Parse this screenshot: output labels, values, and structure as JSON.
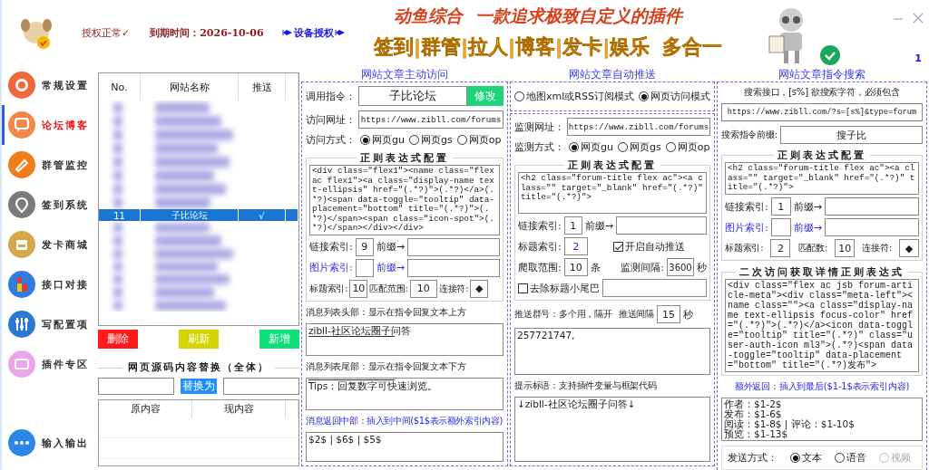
{
  "header": {
    "status": "授权正常✓",
    "expiry": "到期时间：2026-10-06",
    "device_auth": "设备授权",
    "banner_title": "动鱼综合",
    "banner_slogan": "一款追求极致自定义的插件",
    "banner_features": "签到|群管|拉人|博客|发卡|娱乐",
    "banner_suffix": "多合一",
    "badge": "1"
  },
  "sidebar": {
    "items": [
      {
        "label": "常规设置",
        "color": "#f0683c",
        "selected": false
      },
      {
        "label": "论坛博客",
        "color": "#f2884a",
        "selected": true
      },
      {
        "label": "群管监控",
        "color": "#ee7d1a",
        "selected": false
      },
      {
        "label": "签到系统",
        "color": "#7a7a7a",
        "selected": false
      },
      {
        "label": "发卡商城",
        "color": "#d4a84b",
        "selected": false
      },
      {
        "label": "接口对接",
        "color": "#2f7de1",
        "selected": false
      },
      {
        "label": "写配置项",
        "color": "#2a78d4",
        "selected": false
      },
      {
        "label": "插件专区",
        "color": "#eaa6e8",
        "selected": false
      },
      {
        "label": "输入输出",
        "color": "#2e86e8",
        "selected": false
      }
    ]
  },
  "site_table": {
    "columns": [
      "No.",
      "网站名称",
      "推送"
    ],
    "rows": [
      {
        "no": "11",
        "name": "子比论坛",
        "push": "√",
        "selected": true
      }
    ]
  },
  "actions": [
    {
      "label": "删除",
      "color": "#ff1a1a"
    },
    {
      "label": "刷新",
      "color": "#d4d400"
    },
    {
      "label": "新增",
      "color": "#10e07a"
    }
  ],
  "replace": {
    "title": "网页源码内容替换（全体）",
    "button": "替换为",
    "columns": [
      "原内容",
      "现内容"
    ]
  },
  "active_visit": {
    "title": "网站文章主动访问",
    "command_label": "调用指令：",
    "command_value": "子比论坛",
    "modify_button": "修改",
    "url_label": "访问网址：",
    "url": "https://www.zibll.com/forums",
    "method_label": "访问方式：",
    "methods": [
      {
        "label": "网页gu",
        "selected": true
      },
      {
        "label": "网页gs",
        "selected": false
      },
      {
        "label": "网页op",
        "selected": false
      }
    ],
    "regex_title": "正则表达式配置",
    "regex": "<div class=\"flex1\"><name class=\"flex ac flex1\"><a class=\"display-name text-ellipsis\" href=\"(.*?)\">(.*?)</a>(.*?)<span data-toggle=\"tooltip\" data-placement=\"bottom\" title=\"(.*?)\">(.*?)</span><span class=\"icon-spot\">(.*?)</span></div></div>",
    "link_index": {
      "label": "链接索引:",
      "value": "9",
      "prefix_label": "前缀→"
    },
    "image_index": {
      "label": "图片索引:",
      "prefix_label": "前缀→",
      "highlight": true
    },
    "title_index": {
      "label": "标题索引:",
      "value": "10"
    },
    "match_range": {
      "label": "匹配范围:",
      "value": "10"
    },
    "joiner": {
      "label": "连接符:",
      "value": "◆"
    },
    "list_header": {
      "label": "消息列表头部：显示在指令回复文本上方",
      "text": "zibll-社区论坛圈子问答"
    },
    "list_footer": {
      "label": "消息列表尾部：显示在指令回复文本下方",
      "text": "Tips：回复数字可快速浏览。"
    },
    "middle_return": {
      "label": "消息返回中部：插入到中间($1$表示额外索引内容)",
      "text": "$2$ | $6$ | $5$",
      "highlight": true
    }
  },
  "auto_push": {
    "title": "网站文章自动推送",
    "modes": [
      {
        "label": "地图xml或RSS订阅模式",
        "selected": false
      },
      {
        "label": "网页访问模式",
        "selected": true
      }
    ],
    "url_label": "监测网址：",
    "url": "https://www.zibll.com/forums",
    "method_label": "监测方式：",
    "methods": [
      {
        "label": "网页gu",
        "selected": true
      },
      {
        "label": "网页gs",
        "selected": false
      },
      {
        "label": "网页op",
        "selected": false
      }
    ],
    "regex_title": "正则表达式配置",
    "regex": "<h2 class=\"forum-title flex ac\"><a class=\"\" target=\"_blank\" href=\"(.*?)\" title=\"(.*?)\">",
    "link_index": {
      "label": "链接索引:",
      "value": "1",
      "prefix_label": "前缀→"
    },
    "title_index": {
      "label": "标题索引:",
      "value": "2"
    },
    "auto_push": {
      "label": "开启自动推送",
      "checked": true
    },
    "crawl_range": {
      "label": "爬取范围:",
      "value": "10",
      "unit": "条"
    },
    "interval": {
      "label": "监测间隔:",
      "value": "3600",
      "unit": "秒"
    },
    "strip_tail": {
      "label": "去除标题小尾巴",
      "checked": false
    },
    "groups": {
      "label": "推送群号：多个用，隔开",
      "interval_label": "推送间隔",
      "interval": "15",
      "unit": "秒",
      "text": "257721747,"
    },
    "hint": {
      "label": "提示标语：支持插件变量与框架代码",
      "text": "↓zibll-社区论坛圈子问答↓"
    }
  },
  "command_search": {
    "title": "网站文章指令搜索",
    "api_label": "搜索接口，[s%] 欲搜索字符，必须包含",
    "api_url": "https://www.zibll.com/?s=[s%]&type=forum",
    "prefix_label": "搜索指令前缀:",
    "prefix_value": "搜子比",
    "regex_title": "正则表达式配置",
    "regex": "<h2 class=\"forum-title flex ac\"><a class=\"\" target=\"_blank\" href=\"(.*?)\" title=\"(.*?)\">",
    "link_index": {
      "label": "链接索引:",
      "value": "1",
      "prefix_label": "前缀→"
    },
    "image_index": {
      "label": "图片索引:",
      "prefix_label": "前缀→",
      "highlight": true
    },
    "title_index": {
      "label": "标题索引:",
      "value": "2"
    },
    "match_count": {
      "label": "匹配数:",
      "value": "10"
    },
    "joiner": {
      "label": "连接符:",
      "value": "◆"
    },
    "detail_title": "二次访问获取详情正则表达式",
    "detail_regex": "<div class=\"flex ac jsb forum-article-meta\"><div class=\"meta-left\"><name class=\"\"><a class=\"display-name text-ellipsis focus-color\" href=\"(.*?)\">(.*?)</a><icon data-toggle=\"tooltip\" title=\"(.*?)\" class=\"user-auth-icon ml3\">(.*?)<span data-toggle=\"tooltip\" data-placement=\"bottom\" title=\"(.*?)发布\">",
    "extra_return": {
      "label": "额外返回：插入到最后($1-1$表示索引内容)",
      "text": "作者：$1-2$\n发布：$1-6$\n阅读：$1-8$ | 评论：$1-10$\n预览：$1-13$",
      "highlight": true
    },
    "send_label": "发送方式：",
    "send_options": [
      {
        "label": "文本",
        "selected": true,
        "disabled": false
      },
      {
        "label": "语音",
        "selected": false,
        "disabled": false
      },
      {
        "label": "视频",
        "selected": false,
        "disabled": true
      }
    ]
  }
}
